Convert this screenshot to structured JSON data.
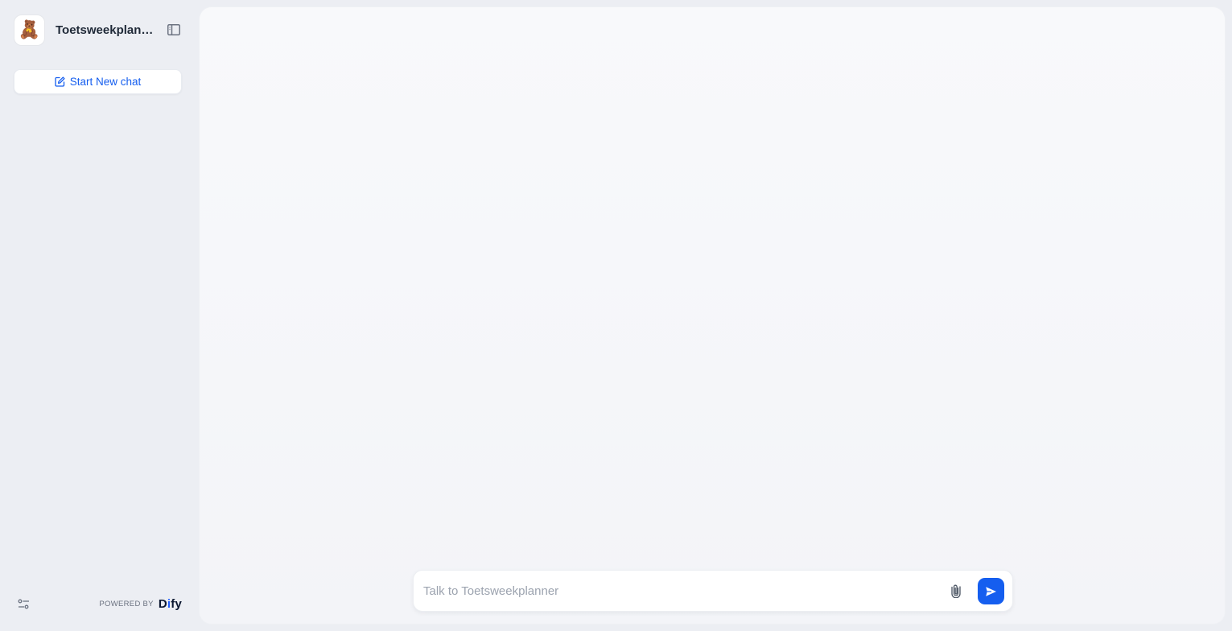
{
  "app": {
    "title": "Toetsweekplanner",
    "avatar_emoji": "🧸"
  },
  "sidebar": {
    "new_chat_label": "Start New chat",
    "powered_by_label": "POWERED BY",
    "brand_name_left": "D",
    "brand_name_accent": "i",
    "brand_name_right": "fy"
  },
  "composer": {
    "placeholder": "Talk to Toetsweekplanner"
  },
  "colors": {
    "accent": "#155eef",
    "page_background": "#eceef3",
    "panel_background": "#f8f9fb"
  },
  "icons": {
    "sidebar_toggle": "sidebar-collapse-icon",
    "new_chat": "edit-square-icon",
    "settings": "sliders-icon",
    "attach": "paperclip-icon",
    "send": "send-icon"
  }
}
